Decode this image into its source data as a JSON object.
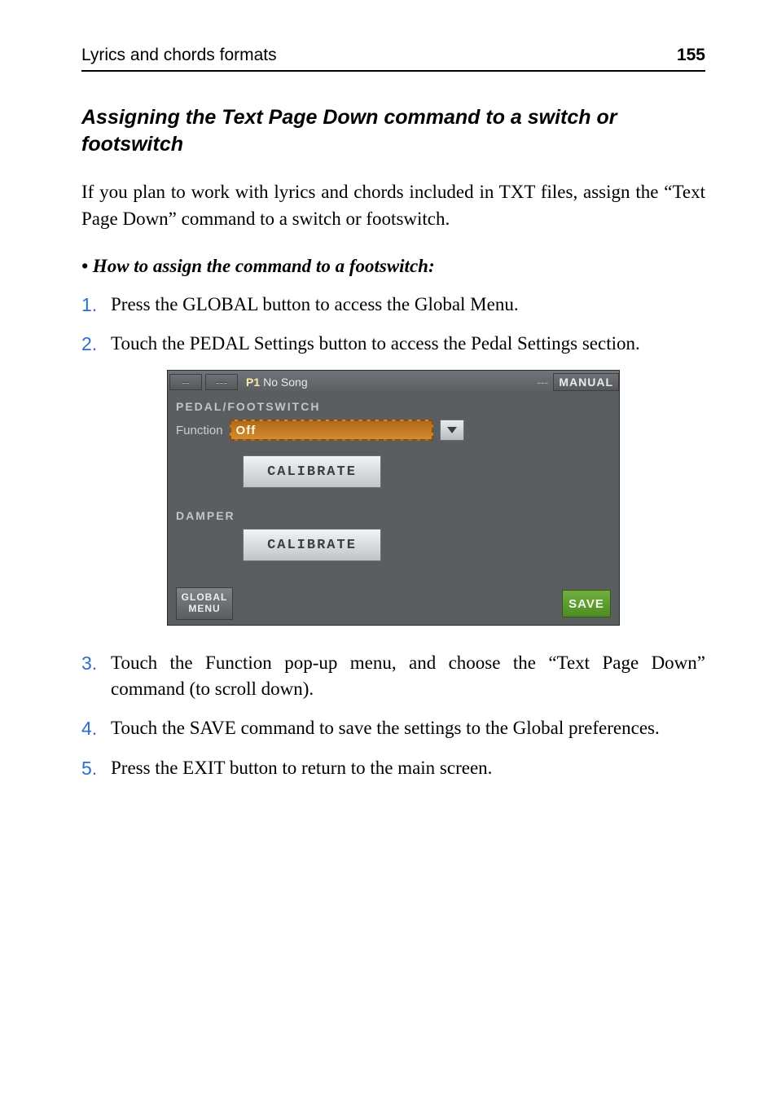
{
  "header": {
    "left": "Lyrics and chords formats",
    "right": "155"
  },
  "section_heading": "Assigning the Text Page Down command to a switch or footswitch",
  "intro": "If you plan to work with lyrics and chords included in TXT files, assign the “Text Page Down” command to a switch or footswitch.",
  "howto_label": "• How to assign the command to a footswitch:",
  "steps_before": [
    {
      "num": "1.",
      "text": "Press the GLOBAL button to access the Global Menu."
    },
    {
      "num": "2.",
      "text": "Touch the PEDAL Settings button to access the Pedal Settings section."
    }
  ],
  "steps_after": [
    {
      "num": "3.",
      "text": "Touch the Function pop-up menu, and choose the “Text Page Down” command (to scroll down)."
    },
    {
      "num": "4.",
      "text": "Touch the SAVE command to save the settings to the Global preferences."
    },
    {
      "num": "5.",
      "text": "Press the EXIT button to return to the main screen."
    }
  ],
  "device": {
    "topbar": {
      "cell1": "--",
      "cell2": "---",
      "p1": "P1",
      "song": "No Song",
      "dashes": "---",
      "manual": "MANUAL"
    },
    "group1_label": "PEDAL/FOOTSWITCH",
    "function_caption": "Function",
    "function_value": "Off",
    "calibrate_label": "CALIBRATE",
    "group2_label": "DAMPER",
    "global_menu": {
      "line1": "GLOBAL",
      "line2": "MENU"
    },
    "save_label": "SAVE"
  }
}
